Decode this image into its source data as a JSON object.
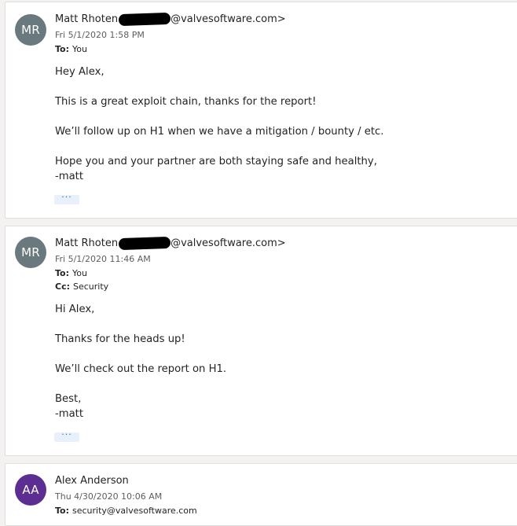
{
  "messages": [
    {
      "avatar": {
        "initials": "MR",
        "color": "#69797e"
      },
      "sender_name": "Matt Rhoten",
      "sender_email_suffix": "@valvesoftware.com>",
      "date": "Fri 5/1/2020 1:58 PM",
      "to_label": "To:",
      "to_value": "You",
      "body": [
        "Hey Alex,",
        "This is a great exploit chain, thanks for the report!",
        "We’ll follow up on H1 when we have a mitigation / bounty / etc.",
        "Hope you and your partner are both staying safe and healthy,",
        "-matt"
      ],
      "ellipsis": "···"
    },
    {
      "avatar": {
        "initials": "MR",
        "color": "#69797e"
      },
      "sender_name": "Matt Rhoten",
      "sender_email_suffix": "@valvesoftware.com>",
      "date": "Fri 5/1/2020 11:46 AM",
      "to_label": "To:",
      "to_value": "You",
      "cc_label": "Cc:",
      "cc_value": "Security",
      "body": [
        "Hi Alex,",
        "Thanks for the heads up!",
        "We’ll check out the report on H1.",
        "Best,",
        "-matt"
      ],
      "ellipsis": "···"
    },
    {
      "avatar": {
        "initials": "AA",
        "color": "#5c2e91"
      },
      "sender_name": "Alex Anderson",
      "date": "Thu 4/30/2020 10:06 AM",
      "to_label": "To:",
      "to_value": "security@valvesoftware.com"
    }
  ]
}
